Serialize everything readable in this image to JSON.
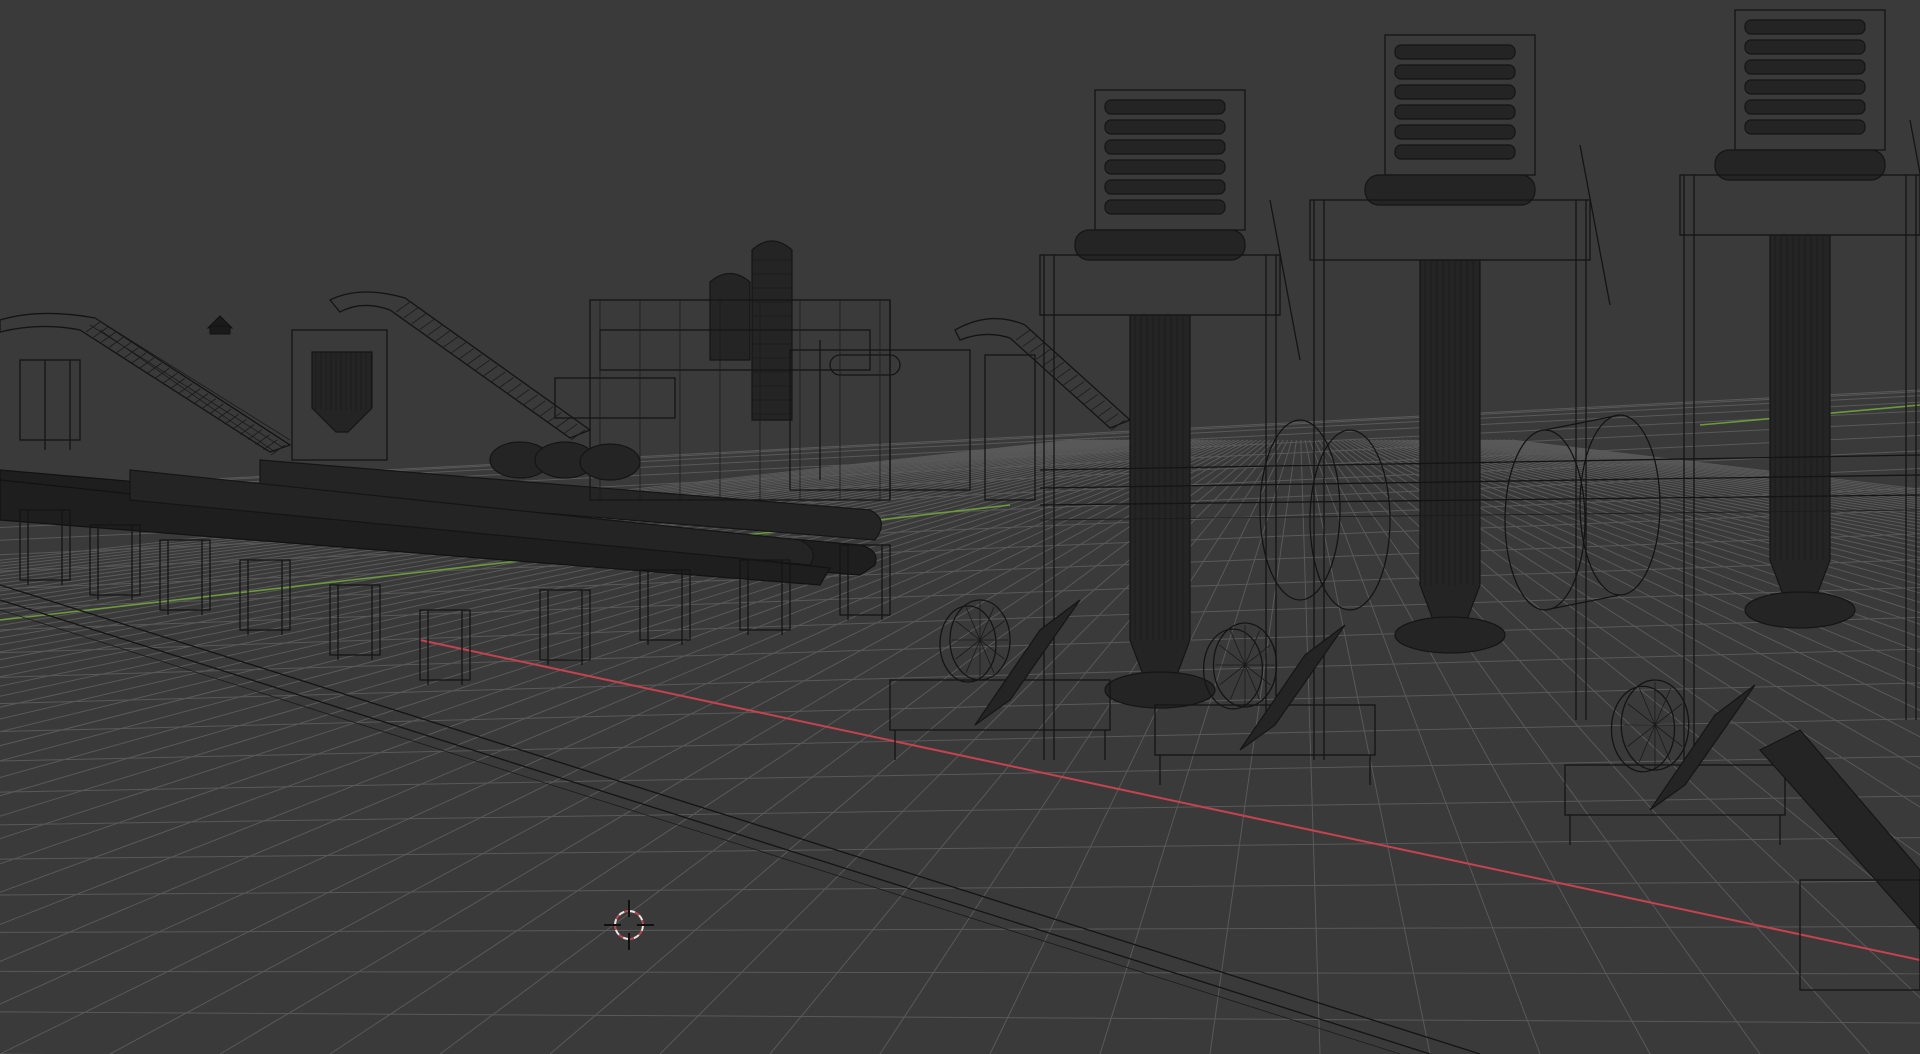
{
  "viewport": {
    "name": "3D Viewport",
    "shading": "wireframe",
    "background_color": "#3a3a3a",
    "grid_color": "#595959",
    "x_axis_color": "#c4434f",
    "y_axis_color": "#6b9a3a",
    "wire_color": "#141414"
  },
  "scene_objects": [
    {
      "name": "conveyor-incline-left",
      "icon": "conveyor"
    },
    {
      "name": "cyclone-hopper",
      "icon": "hopper"
    },
    {
      "name": "conveyor-incline-center",
      "icon": "conveyor"
    },
    {
      "name": "silo-tower",
      "icon": "silo"
    },
    {
      "name": "platform-structure",
      "icon": "platform"
    },
    {
      "name": "rotary-drums",
      "icon": "drum"
    },
    {
      "name": "dryer-tower-1",
      "icon": "tower"
    },
    {
      "name": "dryer-tower-2",
      "icon": "tower"
    },
    {
      "name": "dryer-tower-3",
      "icon": "tower"
    },
    {
      "name": "blower-fans",
      "icon": "fan"
    }
  ],
  "camera_icon": "camera-icon",
  "cursor_icon": "3d-cursor-icon"
}
